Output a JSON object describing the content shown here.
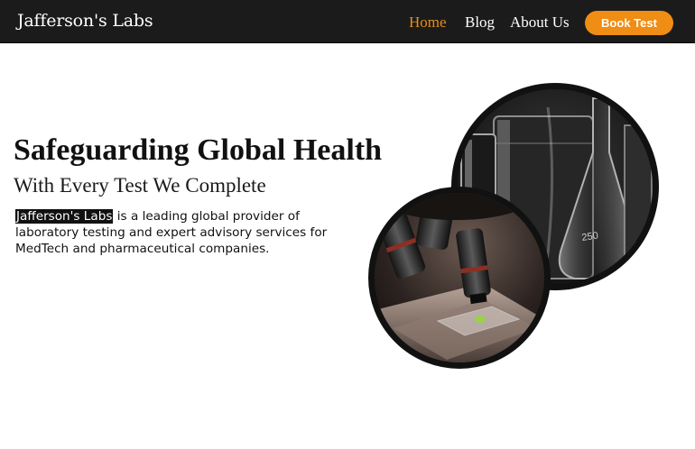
{
  "header": {
    "logo": "Jafferson's Labs",
    "nav": {
      "home": "Home",
      "blog": "Blog",
      "about": "About Us"
    },
    "cta_label": "Book Test"
  },
  "hero": {
    "title": "Safeguarding Global Health",
    "subtitle": "With Every Test We Complete",
    "brand": "Jafferson's Labs",
    "description": " is a leading global provider of laboratory testing and expert advisory services for MedTech and pharmaceutical companies."
  },
  "colors": {
    "nav_background": "#1c1b1b",
    "accent": "#ef8d14",
    "active_link": "#e3901a"
  }
}
